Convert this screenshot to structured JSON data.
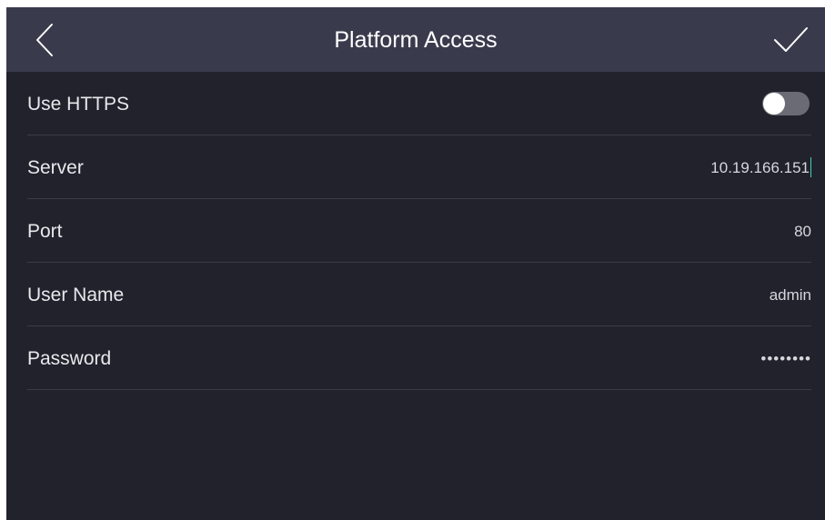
{
  "header": {
    "title": "Platform Access",
    "back_icon": "chevron-left-icon",
    "confirm_icon": "checkmark-icon"
  },
  "settings": {
    "use_https": {
      "label": "Use HTTPS",
      "enabled": false
    },
    "server": {
      "label": "Server",
      "value": "10.19.166.151"
    },
    "port": {
      "label": "Port",
      "value": "80"
    },
    "user_name": {
      "label": "User Name",
      "value": "admin"
    },
    "password": {
      "label": "Password",
      "value": "••••••••"
    }
  },
  "colors": {
    "background": "#22222c",
    "header": "#393b4d",
    "cursor_accent": "#3fd3b6"
  }
}
